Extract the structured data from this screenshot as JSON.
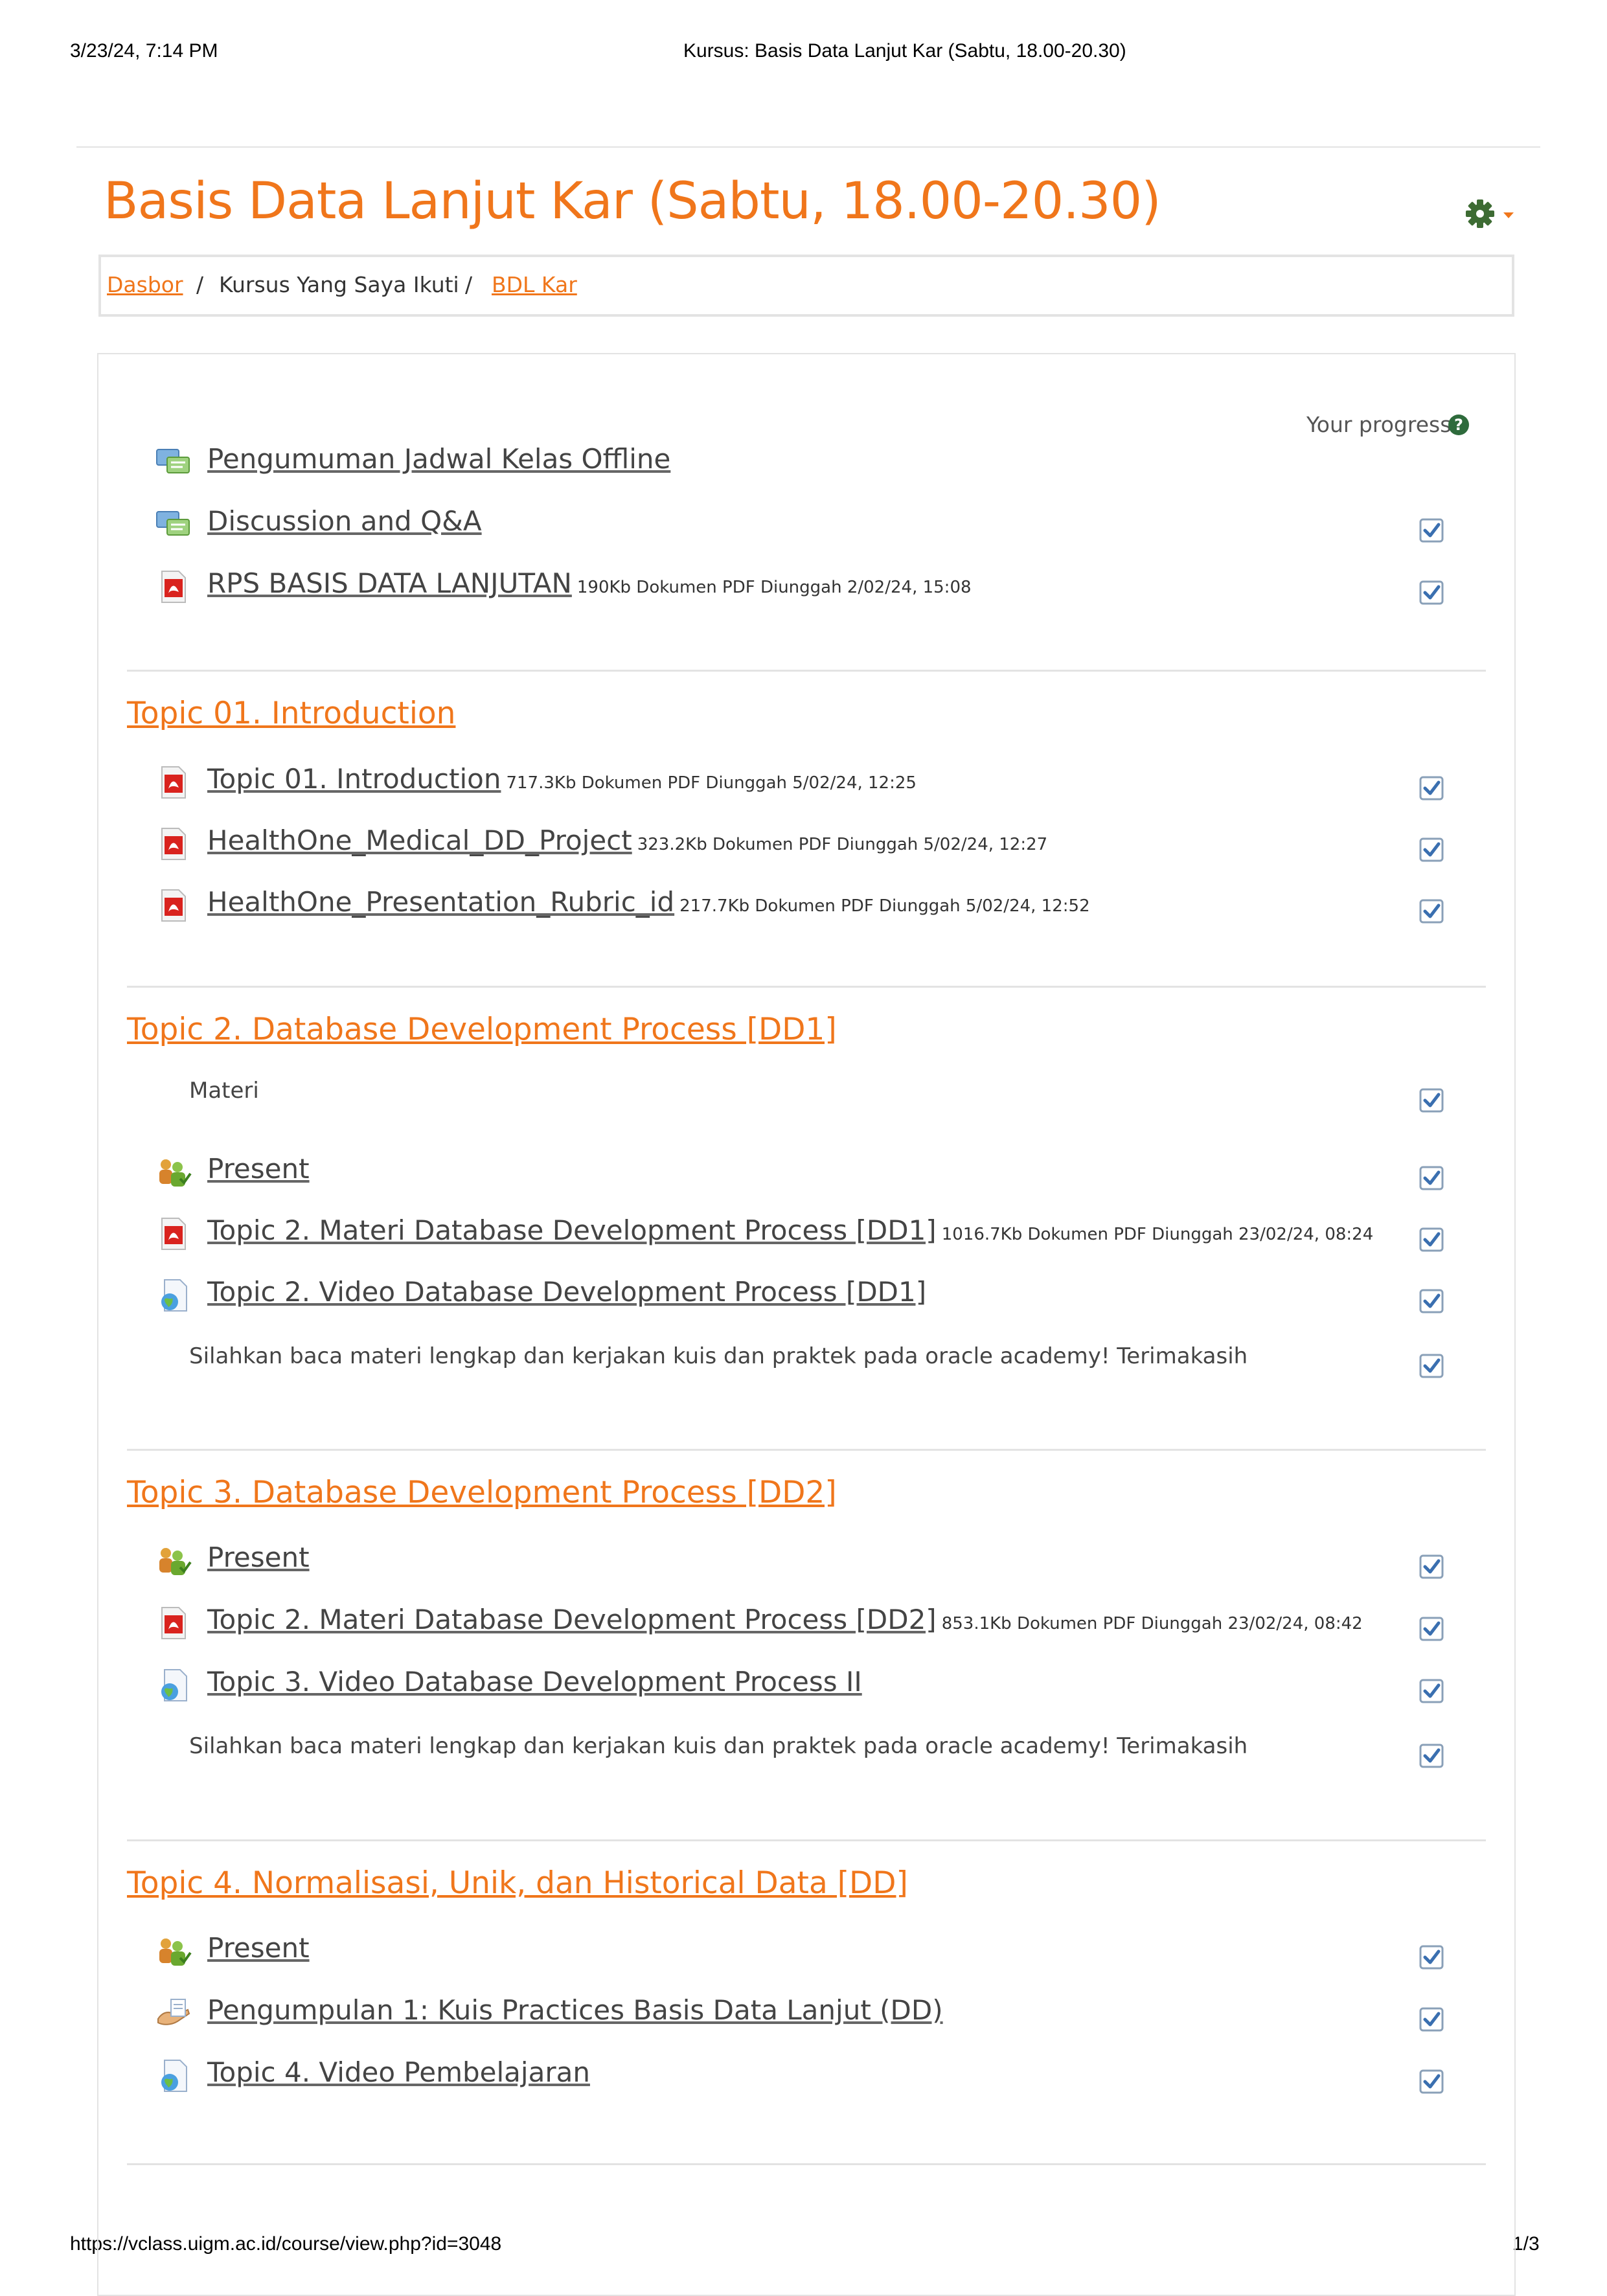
{
  "browser": {
    "datetime": "3/23/24, 7:14 PM",
    "tab_title": "Kursus: Basis Data Lanjut Kar (Sabtu, 18.00-20.30)",
    "url": "https://vclass.uigm.ac.id/course/view.php?id=3048",
    "page_number": "1/3"
  },
  "course": {
    "title": "Basis Data Lanjut Kar (Sabtu, 18.00-20.30)"
  },
  "breadcrumb": {
    "home": "Dasbor",
    "middle": "Kursus Yang Saya Ikuti",
    "current": "BDL Kar",
    "separator": "/"
  },
  "progress_label": "Your progress",
  "help_glyph": "?",
  "general": {
    "items": [
      {
        "label": "Pengumuman Jadwal Kelas Offline",
        "meta": "",
        "icon": "forum-icon",
        "done": null
      },
      {
        "label": "Discussion and Q&A",
        "meta": "",
        "icon": "forum-icon",
        "done": true
      },
      {
        "label": "RPS BASIS DATA LANJUTAN",
        "meta": "190Kb Dokumen PDF Diunggah 2/02/24, 15:08",
        "icon": "pdf-icon",
        "done": true
      }
    ]
  },
  "sections": [
    {
      "title": "Topic 01. Introduction",
      "items": [
        {
          "label": "Topic 01. Introduction",
          "meta": "717.3Kb Dokumen PDF Diunggah 5/02/24, 12:25",
          "icon": "pdf-icon",
          "done": true
        },
        {
          "label": "HealthOne_Medical_DD_Project",
          "meta": "323.2Kb Dokumen PDF Diunggah 5/02/24, 12:27",
          "icon": "pdf-icon",
          "done": true
        },
        {
          "label": "HealthOne_Presentation_Rubric_id",
          "meta": "217.7Kb Dokumen PDF Diunggah 5/02/24, 12:52",
          "icon": "pdf-icon",
          "done": true
        }
      ]
    },
    {
      "title": "Topic 2. Database Development Process [DD1]",
      "label_top": "Materi",
      "items": [
        {
          "label": "Present",
          "meta": "",
          "icon": "attendance-icon",
          "done": true
        },
        {
          "label": "Topic 2. Materi Database Development Process [DD1]",
          "meta": "1016.7Kb Dokumen PDF Diunggah 23/02/24, 08:24",
          "icon": "pdf-icon",
          "done": true
        },
        {
          "label": "Topic 2. Video Database Development Process [DD1]",
          "meta": "",
          "icon": "url-icon",
          "done": true
        }
      ],
      "label_bottom": "Silahkan baca materi lengkap dan kerjakan kuis dan praktek pada oracle academy! Terimakasih"
    },
    {
      "title": "Topic 3. Database Development Process [DD2]",
      "items": [
        {
          "label": "Present",
          "meta": "",
          "icon": "attendance-icon",
          "done": true
        },
        {
          "label": "Topic 2. Materi Database Development Process [DD2]",
          "meta": "853.1Kb Dokumen PDF Diunggah 23/02/24, 08:42",
          "icon": "pdf-icon",
          "done": true
        },
        {
          "label": "Topic 3. Video Database Development Process II",
          "meta": "",
          "icon": "url-icon",
          "done": true
        }
      ],
      "label_bottom": "Silahkan baca materi lengkap dan kerjakan kuis dan praktek pada oracle academy! Terimakasih"
    },
    {
      "title": "Topic 4. Normalisasi, Unik, dan Historical Data [DD]",
      "items": [
        {
          "label": "Present",
          "meta": "",
          "icon": "attendance-icon",
          "done": true
        },
        {
          "label": "Pengumpulan 1: Kuis Practices Basis Data Lanjut (DD)",
          "meta": "",
          "icon": "assignment-icon",
          "done": true
        },
        {
          "label": "Topic 4. Video Pembelajaran",
          "meta": "",
          "icon": "url-icon",
          "done": true
        }
      ]
    }
  ],
  "colors": {
    "accent": "#f0761b",
    "check_border": "#8aa0b8",
    "check_mark": "#3a6fb0"
  }
}
